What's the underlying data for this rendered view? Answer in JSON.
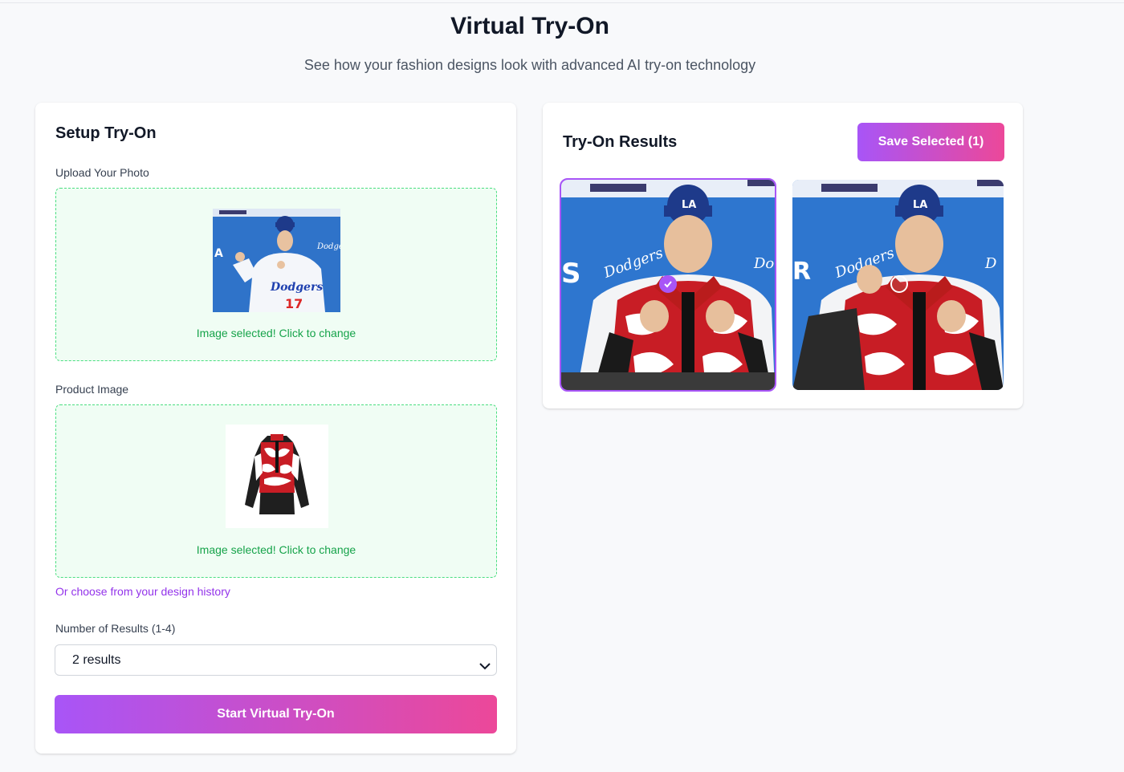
{
  "page": {
    "title": "Virtual Try-On",
    "subtitle": "See how your fashion designs look with advanced AI try-on technology"
  },
  "setup": {
    "title": "Setup Try-On",
    "upload_label": "Upload Your Photo",
    "upload_status": "Image selected! Click to change",
    "product_label": "Product Image",
    "product_status": "Image selected! Click to change",
    "history_link": "Or choose from your design history",
    "results_label": "Number of Results (1-4)",
    "results_selected": "2 results",
    "start_button": "Start Virtual Try-On"
  },
  "results": {
    "title": "Try-On Results",
    "save_button": "Save Selected (1)",
    "items": [
      {
        "selected": true
      },
      {
        "selected": false
      }
    ]
  },
  "colors": {
    "accent_from": "#a855f7",
    "accent_to": "#ec4899",
    "success": "#16a34a",
    "link": "#9333ea"
  },
  "icons": {
    "select": "chevron-down-icon",
    "selected": "check-icon",
    "unselected": "empty-circle-icon"
  }
}
